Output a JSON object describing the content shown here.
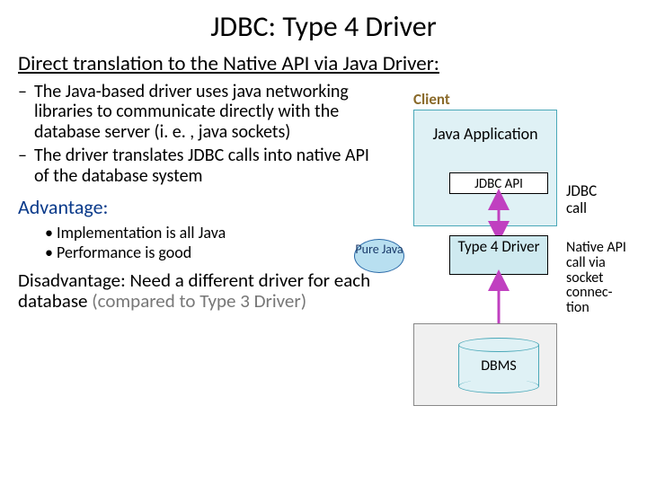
{
  "title": "JDBC:  Type 4 Driver",
  "subtitle": "Direct translation to the Native API via Java Driver:",
  "bullets": [
    "The Java-based driver uses java networking libraries to communicate directly with the database server (i. e. , java sockets)",
    "The driver translates JDBC calls into native API of the database system"
  ],
  "advantage_head": "Advantage:",
  "advantages": [
    "Implementation is all Java",
    "Performance is good"
  ],
  "disadvantage_label": "Disadvantage:  ",
  "disadvantage_body": "Need a different driver for each database ",
  "disadvantage_gray": "(compared to Type 3 Driver)",
  "diagram": {
    "client": "Client",
    "javaapp": "Java Application",
    "jdbcapi": "JDBC API",
    "type4": "Type 4 Driver",
    "purejava": "Pure Java",
    "dbms": "DBMS",
    "jdbc_call": "JDBC call",
    "native_call": "Native API call via socket connec-tion"
  }
}
